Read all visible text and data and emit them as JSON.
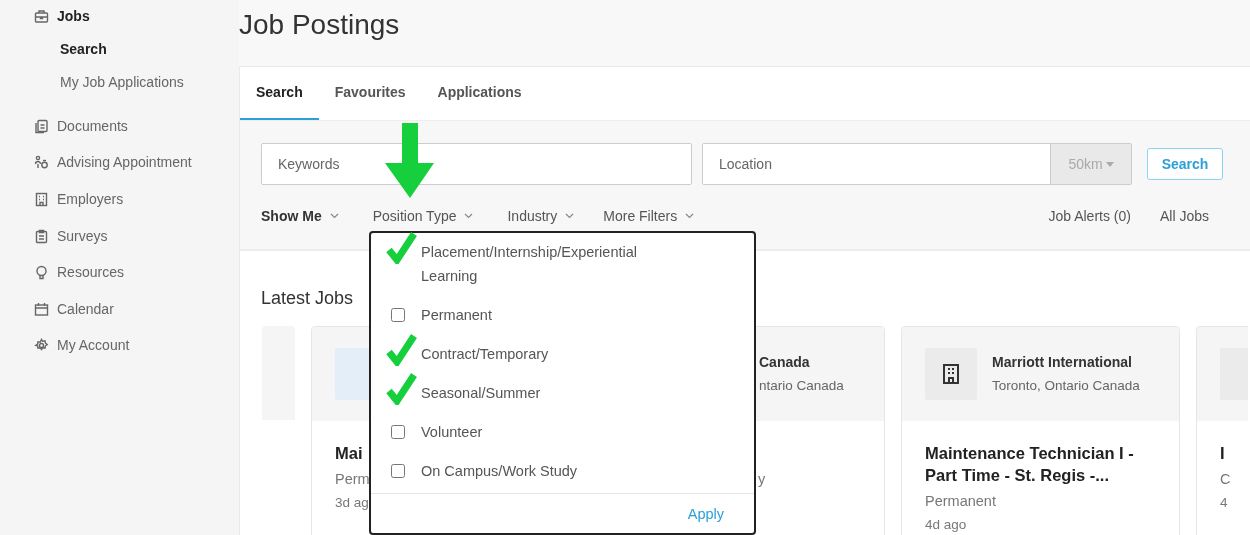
{
  "page_title": "Job Postings",
  "sidebar": {
    "items": [
      {
        "label": "Jobs",
        "expanded": true,
        "children": [
          {
            "label": "Search",
            "selected": true
          },
          {
            "label": "My Job Applications",
            "selected": false
          }
        ]
      },
      {
        "label": "Documents"
      },
      {
        "label": "Advising Appointment"
      },
      {
        "label": "Employers"
      },
      {
        "label": "Surveys"
      },
      {
        "label": "Resources"
      },
      {
        "label": "Calendar"
      },
      {
        "label": "My Account"
      }
    ]
  },
  "tabs": [
    {
      "label": "Search",
      "selected": true
    },
    {
      "label": "Favourites",
      "selected": false
    },
    {
      "label": "Applications",
      "selected": false
    }
  ],
  "search": {
    "keywords_placeholder": "Keywords",
    "location_placeholder": "Location",
    "radius": "50km",
    "button": "Search"
  },
  "filters": [
    {
      "label": "Show Me"
    },
    {
      "label": "Position Type"
    },
    {
      "label": "Industry"
    },
    {
      "label": "More Filters"
    }
  ],
  "links": [
    "Job Alerts (0)",
    "All Jobs"
  ],
  "position_type_menu": {
    "options": [
      {
        "label": "Placement/Internship/Experiential Learning",
        "checked": true
      },
      {
        "label": "Permanent",
        "checked": false
      },
      {
        "label": "Contract/Temporary",
        "checked": true
      },
      {
        "label": "Seasonal/Summer",
        "checked": true
      },
      {
        "label": "Volunteer",
        "checked": false
      },
      {
        "label": "On Campus/Work Study",
        "checked": false
      }
    ],
    "apply": "Apply"
  },
  "latest_jobs": {
    "title": "Latest Jobs",
    "cards": [
      {
        "kind": "edge"
      },
      {
        "kind": "photo-logo",
        "title": "Mai",
        "type": "Perm",
        "posted": "3d ag"
      },
      {
        "kind": "tail",
        "company": "Canada",
        "location": "ntario Canada",
        "type": "y"
      },
      {
        "kind": "building-logo",
        "company": "Marriott International",
        "location": "Toronto, Ontario Canada",
        "title": "Maintenance Technician I - Part Time - St. Regis -...",
        "type": "Permanent",
        "posted": "4d ago"
      },
      {
        "kind": "blank-logo",
        "title": "I",
        "type": "C",
        "posted": "4"
      }
    ]
  }
}
